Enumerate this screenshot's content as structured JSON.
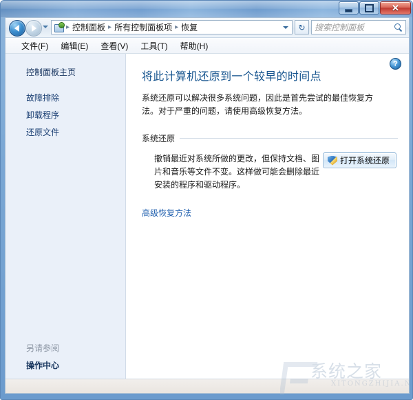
{
  "window": {
    "titlebar": {
      "minimize_label": "─",
      "maximize_label": "□",
      "close_label": "✕"
    }
  },
  "navbar": {
    "back_tooltip": "后退",
    "forward_tooltip": "前进",
    "breadcrumbs": [
      "控制面板",
      "所有控制面板项",
      "恢复"
    ],
    "separator": "▸",
    "refresh_label": "↻",
    "search_placeholder": "搜索控制面板",
    "search_value": ""
  },
  "menubar": {
    "items": [
      "文件(F)",
      "编辑(E)",
      "查看(V)",
      "工具(T)",
      "帮助(H)"
    ]
  },
  "sidebar": {
    "home_label": "控制面板主页",
    "links": [
      "故障排除",
      "卸载程序",
      "还原文件"
    ],
    "see_also_heading": "另请参阅",
    "see_also_links": [
      "操作中心"
    ]
  },
  "content": {
    "help_label": "?",
    "title": "将此计算机还原到一个较早的时间点",
    "description": "系统还原可以解决很多系统问题，因此是首先尝试的最佳恢复方法。对于严重的问题，请使用高级恢复方法。",
    "section_heading": "系统还原",
    "section_text": "撤销最近对系统所做的更改，但保持文档、图片和音乐等文件不变。这样做可能会删除最近安装的程序和驱动程序。",
    "restore_button_label": "打开系统还原",
    "advanced_link": "高级恢复方法"
  },
  "statusbar": {
    "text": ""
  },
  "watermark": {
    "main": "系统之家",
    "sub": "XITONGZHIJIA.NET",
    "center": ""
  },
  "colors": {
    "accent": "#17558f",
    "link": "#1f5fae",
    "titlebar": "#6c9acd",
    "sidebar_bg": "#eaf0f9"
  }
}
